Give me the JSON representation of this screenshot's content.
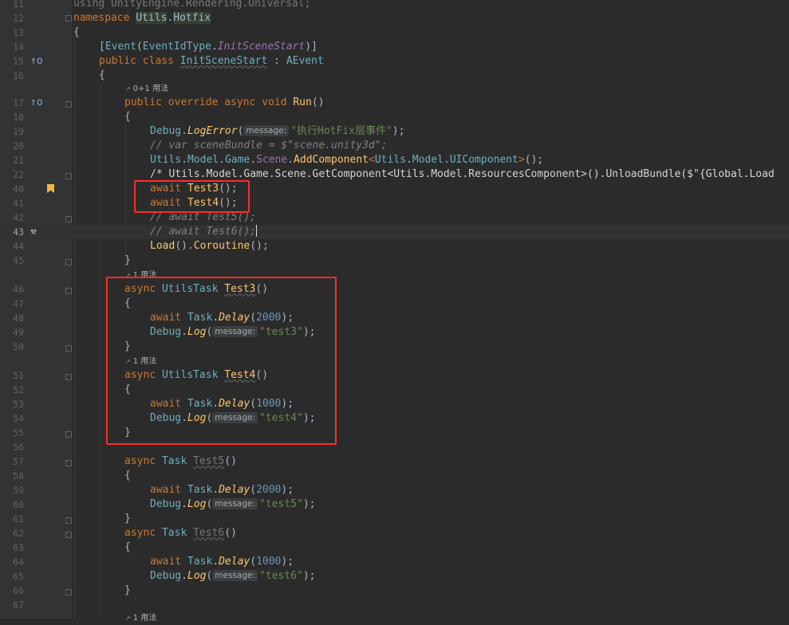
{
  "editor": {
    "line_numbers": [
      "11",
      "12",
      "13",
      "14",
      "15",
      "16",
      "17",
      "18",
      "19",
      "20",
      "21",
      "22",
      "40",
      "41",
      "42",
      "43",
      "44",
      "45",
      "46",
      "47",
      "48",
      "49",
      "50",
      "51",
      "52",
      "53",
      "54",
      "55",
      "56",
      "57",
      "58",
      "59",
      "60",
      "61",
      "62",
      "63",
      "64",
      "65",
      "66",
      "67"
    ],
    "usage_hints": {
      "run": "0+1 用法",
      "test3": "1 用法",
      "test4": "1 用法",
      "bottom": "1 用法"
    },
    "param_hint": "message:",
    "lines": {
      "l11": "using UnityEngine.Rendering.Universal;",
      "ns_kw": "namespace",
      "ns_name1": "Utils",
      "ns_name2": "Hotfix",
      "attr_event": "Event",
      "attr_type": "EventIdType",
      "attr_field": "InitSceneStart",
      "cls_mods": "public class",
      "cls_name": "InitSceneStart",
      "cls_base": "AEvent",
      "run_mods": "public override async void",
      "run_name": "Run",
      "debug": "Debug",
      "log_error": "LogError",
      "log": "Log",
      "str_hotfix": "\"执行HotFix层事件\"",
      "cmt_scene": "// var sceneBundle = $\"scene.unity3d\";",
      "utils": "Utils",
      "model": "Model",
      "game": "Game",
      "scene": "Scene",
      "add_component": "AddComponent",
      "ui_component": "UIComponent",
      "block_comment": "/* Utils.Model.Game.Scene.GetComponent<Utils.Model.ResourcesComponent>().UnloadBundle($\"{Global.Load",
      "await": "await",
      "test3": "Test3",
      "test4": "Test4",
      "cmt_test5": "// await Test5();",
      "cmt_test6": "// await Test6();",
      "load": "Load",
      "coroutine": "Coroutine",
      "async": "async",
      "utils_task": "UtilsTask",
      "task": "Task",
      "delay": "Delay",
      "n2000": "2000",
      "n1000": "1000",
      "str_test3": "\"test3\"",
      "str_test4": "\"test4\"",
      "str_test5": "\"test5\"",
      "str_test6": "\"test6\"",
      "test5": "Test5",
      "test6": "Test6"
    }
  },
  "colors": {
    "background": "#2b2b2b",
    "gutter": "#313335",
    "keyword": "#cc7832",
    "type": "#6fafbd",
    "method": "#ffc66d",
    "string": "#6a8759",
    "number": "#6897bb",
    "comment": "#808080",
    "highlight_box": "#ff2b2b",
    "bookmark": "#ecb73c"
  }
}
